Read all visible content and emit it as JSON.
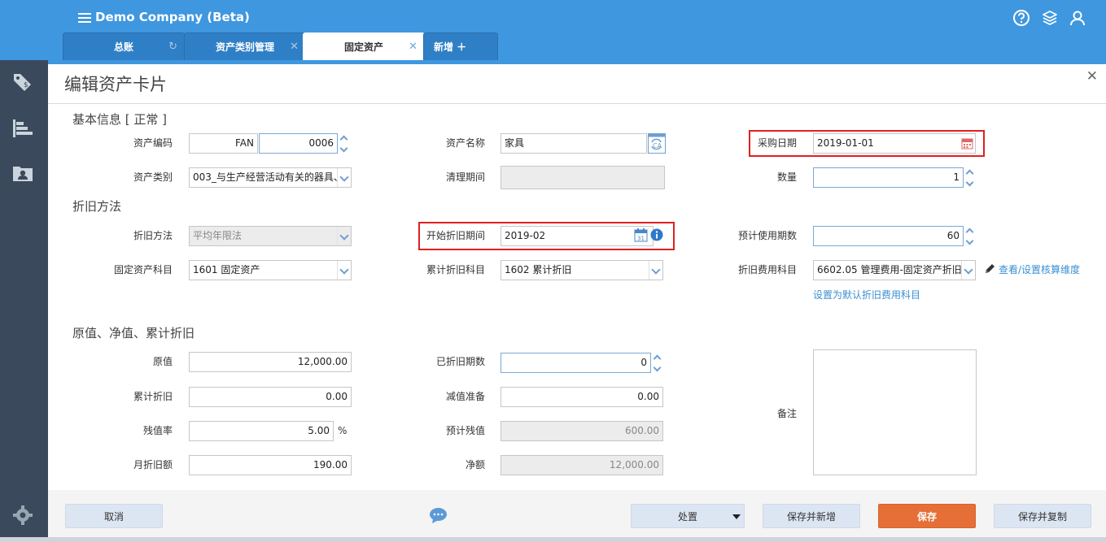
{
  "app": {
    "title": "Demo Company (Beta)"
  },
  "tabs": [
    {
      "label": "总账",
      "close": "↻"
    },
    {
      "label": "资产类别管理",
      "close": "✕"
    },
    {
      "label": "固定资产",
      "close": "✕"
    },
    {
      "label": "新增 ＋",
      "close": ""
    }
  ],
  "page": {
    "title": "编辑资产卡片",
    "close": "✕"
  },
  "sections": {
    "basic": "基本信息 [ 正常 ]",
    "depr": "折旧方法",
    "values": "原值、净值、累计折旧"
  },
  "fields": {
    "asset_code": {
      "label": "资产编码",
      "prefix": "FAN",
      "number": "0006"
    },
    "asset_name": {
      "label": "资产名称",
      "value": "家具"
    },
    "purchase_date": {
      "label": "采购日期",
      "value": "2019-01-01"
    },
    "asset_category": {
      "label": "资产类别",
      "value": "003_与生产经营活动有关的器具、"
    },
    "cleanup_period": {
      "label": "清理期间",
      "value": ""
    },
    "quantity": {
      "label": "数量",
      "value": "1"
    },
    "depr_method": {
      "label": "折旧方法",
      "value": "平均年限法"
    },
    "depr_start": {
      "label": "开始折旧期间",
      "value": "2019-02"
    },
    "useful_periods": {
      "label": "预计使用期数",
      "value": "60"
    },
    "fa_account": {
      "label": "固定资产科目",
      "value": "1601 固定资产"
    },
    "accum_account": {
      "label": "累计折旧科目",
      "value": "1602 累计折旧"
    },
    "expense_account": {
      "label": "折旧费用科目",
      "value": "6602.05 管理费用-固定资产折旧"
    },
    "original_value": {
      "label": "原值",
      "value": "12,000.00"
    },
    "depr_periods": {
      "label": "已折旧期数",
      "value": "0"
    },
    "accum_depr": {
      "label": "累计折旧",
      "value": "0.00"
    },
    "impairment": {
      "label": "减值准备",
      "value": "0.00"
    },
    "residual_rate": {
      "label": "残值率",
      "value": "5.00",
      "unit": "%"
    },
    "est_residual": {
      "label": "预计残值",
      "value": "600.00"
    },
    "monthly_depr": {
      "label": "月折旧额",
      "value": "190.00"
    },
    "net_value": {
      "label": "净额",
      "value": "12,000.00"
    },
    "remarks": {
      "label": "备注",
      "value": ""
    }
  },
  "links": {
    "view_dims": "查看/设置核算维度",
    "set_default": "设置为默认折旧费用科目"
  },
  "buttons": {
    "cancel": "取消",
    "handle": "处置",
    "save_new": "保存并新增",
    "save": "保存",
    "save_copy": "保存并复制"
  },
  "colors": {
    "header_blue": "#3f97df",
    "sidebar": "#3a4a5c",
    "primary_orange": "#e56f37",
    "highlight_red": "#e02020"
  }
}
